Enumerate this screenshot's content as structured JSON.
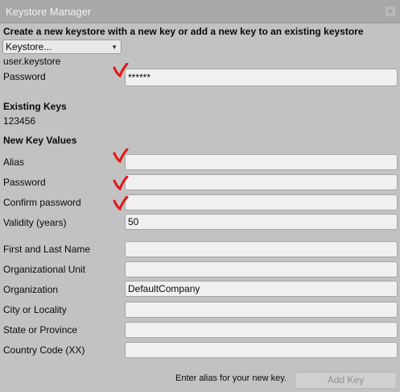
{
  "window": {
    "title": "Keystore Manager",
    "close_icon": "≡"
  },
  "header": {
    "instruction": "Create a new keystore with a new key or add a new key to an existing keystore"
  },
  "keystore": {
    "dropdown_value": "Keystore...",
    "file_name": "user.keystore",
    "password_label": "Password",
    "password_value": "******"
  },
  "existing_keys": {
    "title": "Existing Keys",
    "value": "123456"
  },
  "new_key": {
    "title": "New Key Values",
    "alias_label": "Alias",
    "alias_value": "",
    "password_label": "Password",
    "password_value": "",
    "confirm_label": "Confirm password",
    "confirm_value": "",
    "validity_label": "Validity (years)",
    "validity_value": "50",
    "first_last_label": "First and Last Name",
    "first_last_value": "",
    "org_unit_label": "Organizational Unit",
    "org_unit_value": "",
    "organization_label": "Organization",
    "organization_value": "DefaultCompany",
    "city_label": "City or Locality",
    "city_value": "",
    "state_label": "State or Province",
    "state_value": "",
    "country_label": "Country Code (XX)",
    "country_value": ""
  },
  "footer": {
    "hint": "Enter alias for your new key.",
    "add_key_label": "Add Key"
  },
  "colors": {
    "annotation_red": "#e0191a"
  }
}
